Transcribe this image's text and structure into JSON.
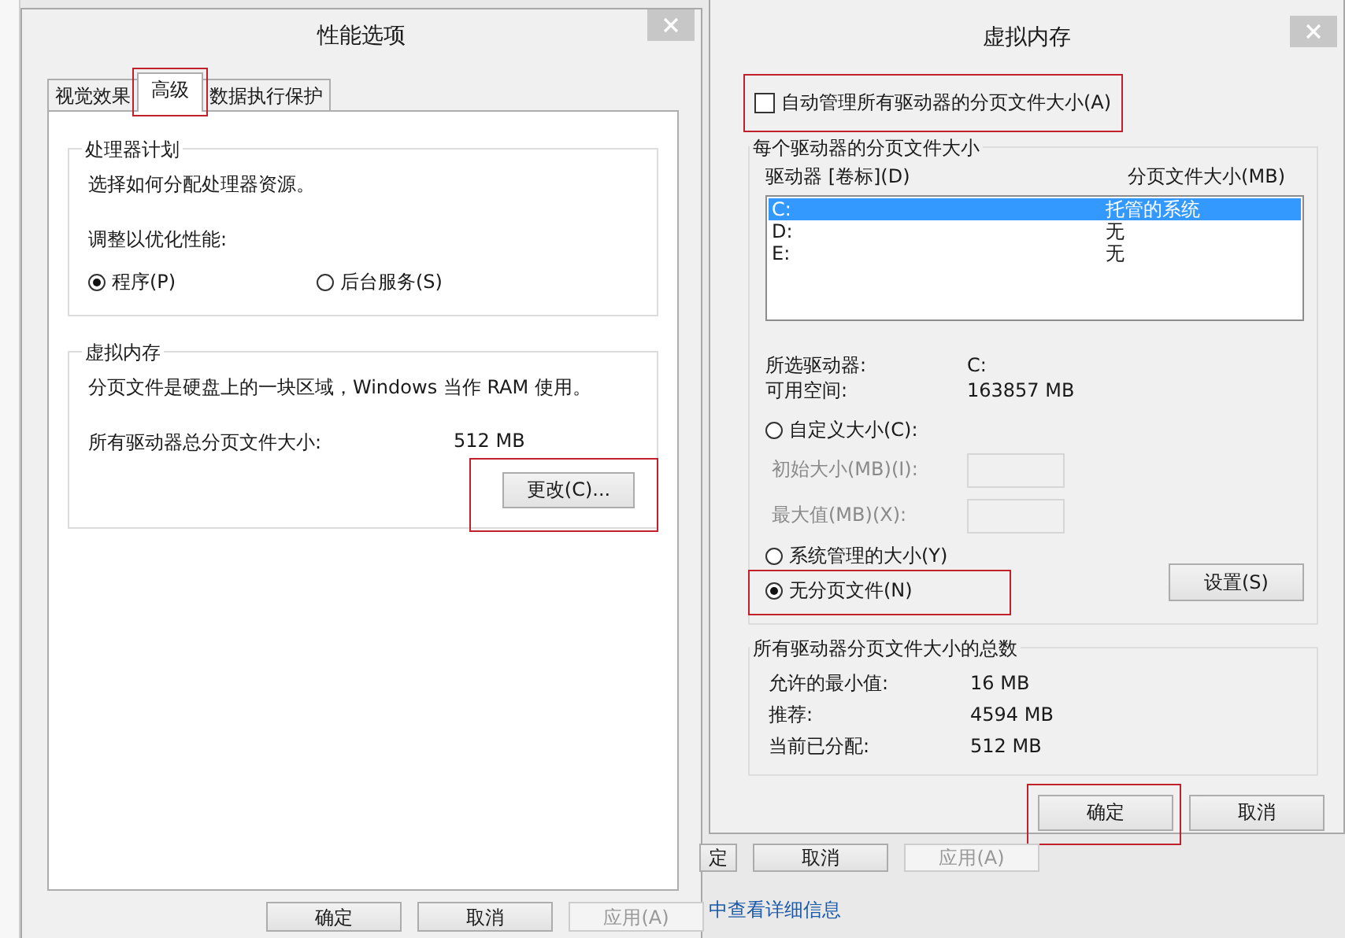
{
  "performance_dialog": {
    "title": "性能选项",
    "tabs": [
      {
        "label": "视觉效果",
        "selected": false,
        "highlighted": false
      },
      {
        "label": "高级",
        "selected": true,
        "highlighted": true
      },
      {
        "label": "数据执行保护",
        "selected": false,
        "highlighted": false
      }
    ],
    "processor_group": {
      "title": "处理器计划",
      "description": "选择如何分配处理器资源。",
      "prompt": "调整以优化性能:",
      "options": [
        {
          "label": "程序(P)",
          "selected": true
        },
        {
          "label": "后台服务(S)",
          "selected": false
        }
      ]
    },
    "virtual_memory_group": {
      "title": "虚拟内存",
      "description": "分页文件是硬盘上的一块区域，Windows 当作 RAM 使用。",
      "total_label": "所有驱动器总分页文件大小:",
      "total_value": "512 MB",
      "change_button": {
        "label": "更改(C)...",
        "highlighted": true
      }
    },
    "buttons": [
      {
        "label": "确定",
        "disabled": false
      },
      {
        "label": "取消",
        "disabled": false
      },
      {
        "label": "应用(A)",
        "disabled": true
      }
    ]
  },
  "virtual_memory_dialog": {
    "title": "虚拟内存",
    "auto_manage": {
      "label": "自动管理所有驱动器的分页文件大小(A)",
      "checked": false,
      "highlighted": true
    },
    "per_drive_group": {
      "title": "每个驱动器的分页文件大小",
      "columns": [
        "驱动器 [卷标](D)",
        "分页文件大小(MB)"
      ],
      "drives": [
        {
          "drive": "C:",
          "size": "托管的系统",
          "selected": true
        },
        {
          "drive": "D:",
          "size": "无",
          "selected": false
        },
        {
          "drive": "E:",
          "size": "无",
          "selected": false
        }
      ],
      "info": [
        {
          "label": "所选驱动器:",
          "value": "C:"
        },
        {
          "label": "可用空间:",
          "value": "163857 MB"
        }
      ],
      "size_options": [
        {
          "label": "自定义大小(C):",
          "selected": false,
          "highlighted": false
        },
        {
          "label": "系统管理的大小(Y)",
          "selected": false,
          "highlighted": false
        },
        {
          "label": "无分页文件(N)",
          "selected": true,
          "highlighted": true
        }
      ],
      "custom_fields": [
        {
          "label": "初始大小(MB)(I):",
          "disabled": true
        },
        {
          "label": "最大值(MB)(X):",
          "disabled": true
        }
      ],
      "set_button": {
        "label": "设置(S)"
      }
    },
    "totals_group": {
      "title": "所有驱动器分页文件大小的总数",
      "rows": [
        {
          "label": "允许的最小值:",
          "value": "16 MB"
        },
        {
          "label": "推荐:",
          "value": "4594 MB"
        },
        {
          "label": "当前已分配:",
          "value": "512 MB"
        }
      ]
    },
    "buttons": [
      {
        "label": "确定",
        "disabled": false,
        "highlighted": true
      },
      {
        "label": "取消",
        "disabled": false,
        "highlighted": false
      }
    ]
  },
  "background_window": {
    "buttons": [
      {
        "label": "定",
        "disabled": false
      },
      {
        "label": "取消",
        "disabled": false
      },
      {
        "label": "应用(A)",
        "disabled": true
      }
    ],
    "link": "中查看详细信息"
  }
}
